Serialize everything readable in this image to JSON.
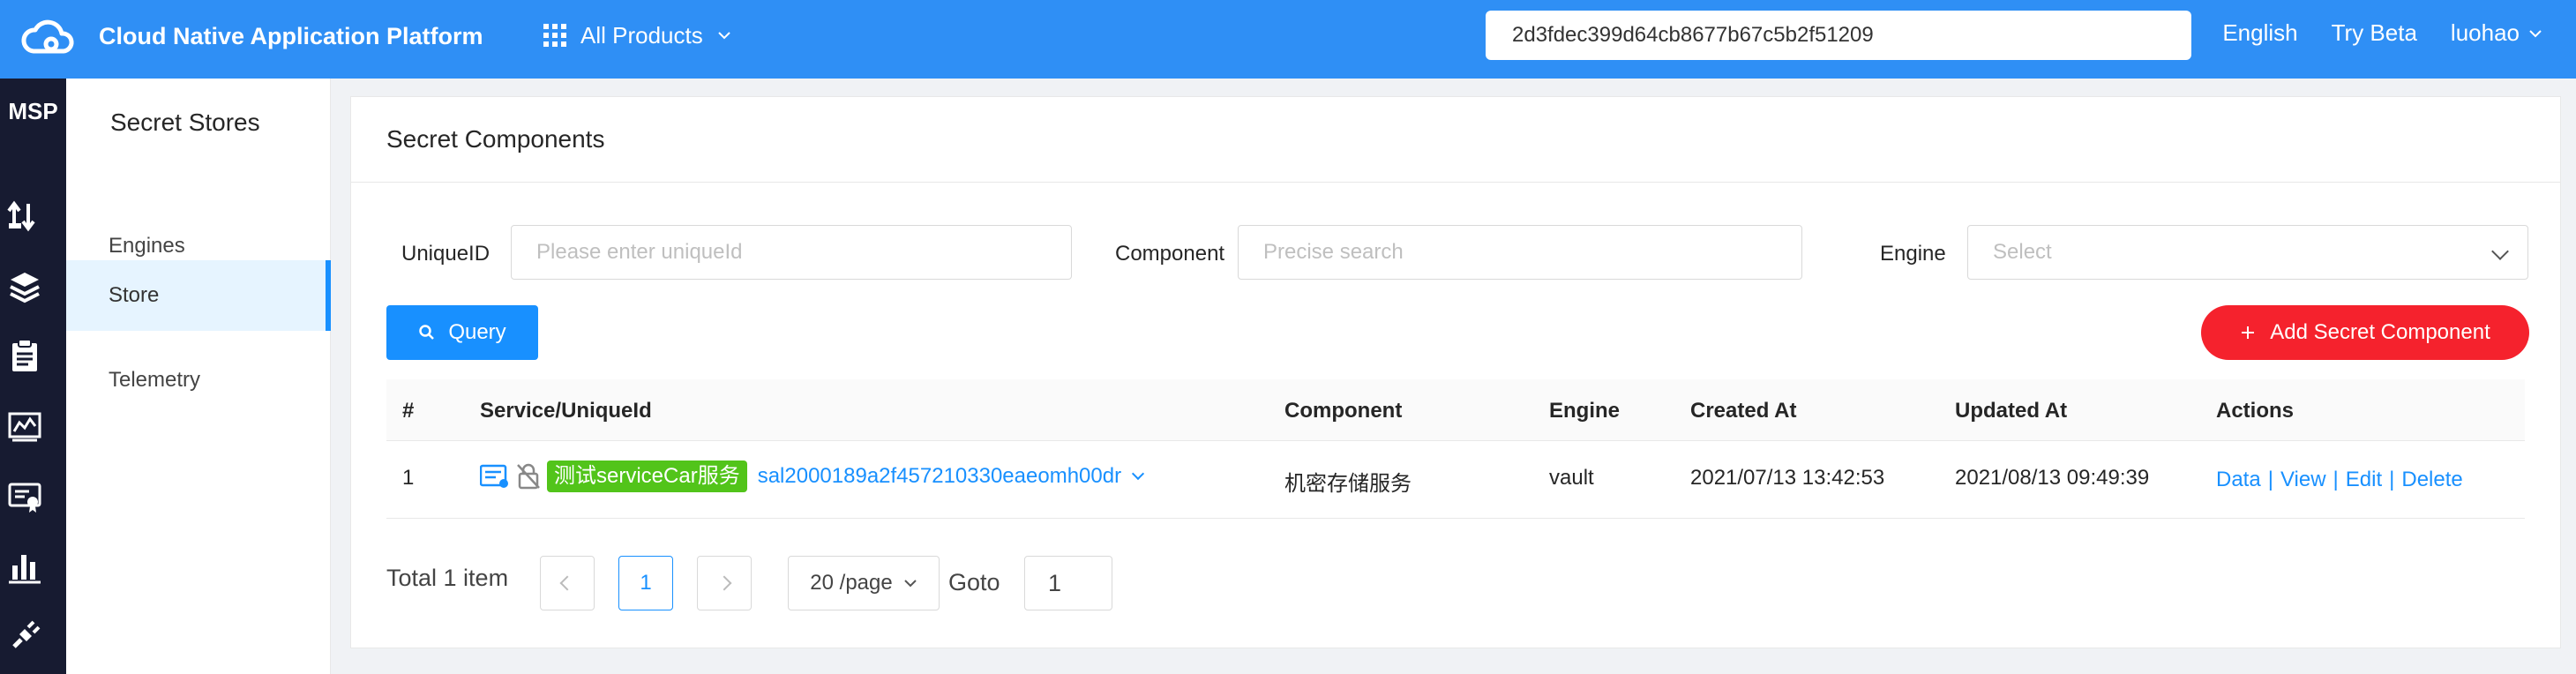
{
  "topbar": {
    "app_title": "Cloud Native Application Platform",
    "products_label": "All Products",
    "search_value": "2d3fdec399d64cb8677b67c5b2f51209",
    "language": "English",
    "try_beta": "Try Beta",
    "user": "luohao"
  },
  "rail": {
    "label": "MSP",
    "icons": [
      "transfer-icon",
      "layers-icon",
      "clipboard-icon",
      "monitor-chart-icon",
      "certificate-icon",
      "bar-chart-icon",
      "plug-icon"
    ]
  },
  "sidebar": {
    "title": "Secret Stores",
    "items": [
      {
        "label": "Engines"
      },
      {
        "label": "Store"
      },
      {
        "label": "Telemetry"
      }
    ]
  },
  "panel": {
    "title": "Secret Components",
    "filters": {
      "unique_label": "UniqueID",
      "unique_placeholder": "Please enter uniqueId",
      "component_label": "Component",
      "component_placeholder": "Precise search",
      "engine_label": "Engine",
      "engine_placeholder": "Select"
    },
    "query_button": "Query",
    "add_button": "Add Secret Component"
  },
  "table": {
    "columns": [
      "#",
      "Service/UniqueId",
      "Component",
      "Engine",
      "Created At",
      "Updated At",
      "Actions"
    ],
    "rows": [
      {
        "index": "1",
        "service_tag": "测试serviceCar服务",
        "unique_id": "sal2000189a2f457210330eaeomh00dr",
        "component": "机密存储服务",
        "engine": "vault",
        "created_at": "2021/07/13 13:42:53",
        "updated_at": "2021/08/13 09:49:39",
        "actions": [
          "Data",
          "View",
          "Edit",
          "Delete"
        ]
      }
    ]
  },
  "pagination": {
    "total": "Total 1 item",
    "current_page": "1",
    "page_size": "20 /page",
    "goto_label": "Goto",
    "goto_value": "1"
  },
  "colors": {
    "topbar": "#2f8ff5",
    "rail": "#171b31",
    "primary": "#1890ff",
    "danger": "#f5222d",
    "tag": "#52c41a"
  }
}
